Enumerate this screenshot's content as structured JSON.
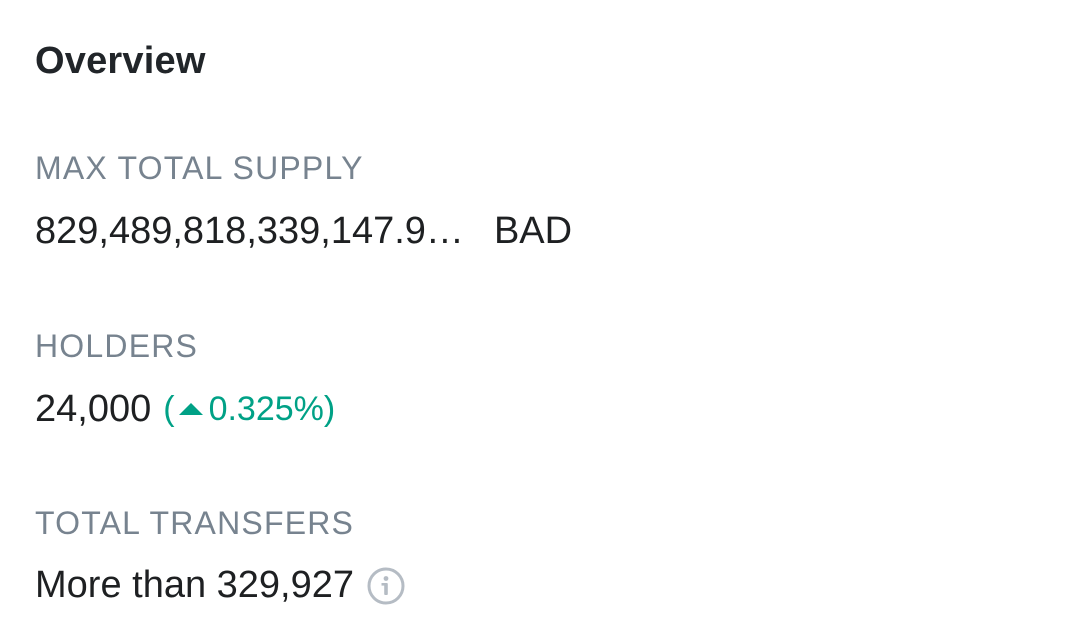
{
  "overview": {
    "title": "Overview",
    "max_total_supply": {
      "label": "MAX TOTAL SUPPLY",
      "value": "829,489,818,339,147.9…",
      "symbol": "BAD"
    },
    "holders": {
      "label": "HOLDERS",
      "value": "24,000",
      "change_open": "(",
      "change_value": "0.325%)",
      "change_direction": "up",
      "change_color": "#00a186"
    },
    "total_transfers": {
      "label": "TOTAL TRANSFERS",
      "value": "More than 329,927",
      "info_icon": "info-circle-icon"
    }
  }
}
